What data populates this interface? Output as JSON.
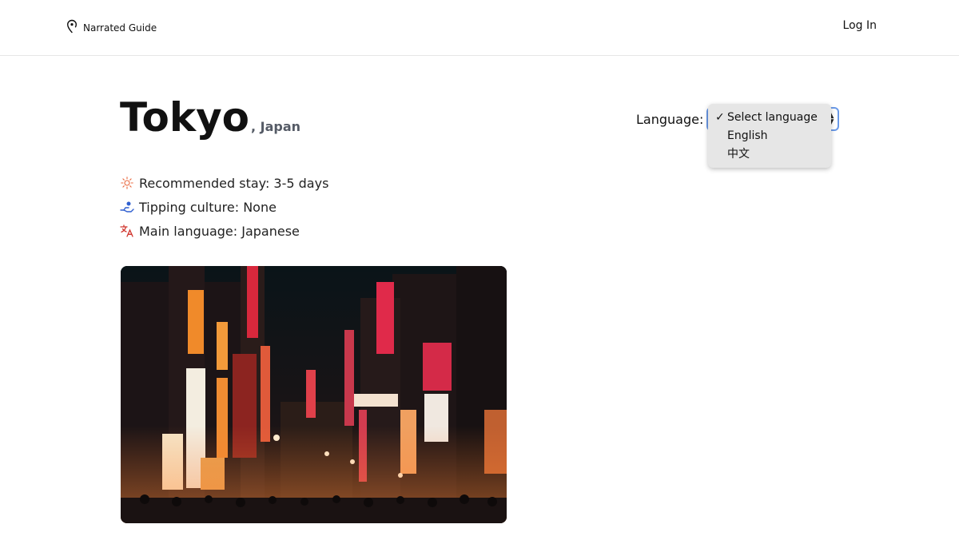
{
  "header": {
    "brand": "Narrated Guide",
    "login": "Log In"
  },
  "destination": {
    "city": "Tokyo",
    "country": ", Japan"
  },
  "facts": [
    {
      "icon": "sun-icon",
      "text": "Recommended stay: 3-5 days"
    },
    {
      "icon": "tip-hand-icon",
      "text": "Tipping culture: None"
    },
    {
      "icon": "translate-icon",
      "text": "Main language: Japanese"
    }
  ],
  "language": {
    "label": "Language:",
    "options": [
      "Select language",
      "English",
      "中文"
    ],
    "selected_index": 0,
    "check": "✓"
  },
  "colors": {
    "accent_border": "#6b9ae8",
    "sun_icon": "#e8663c",
    "tip_icon": "#2f5fd0",
    "translate_icon": "#d0342c"
  }
}
